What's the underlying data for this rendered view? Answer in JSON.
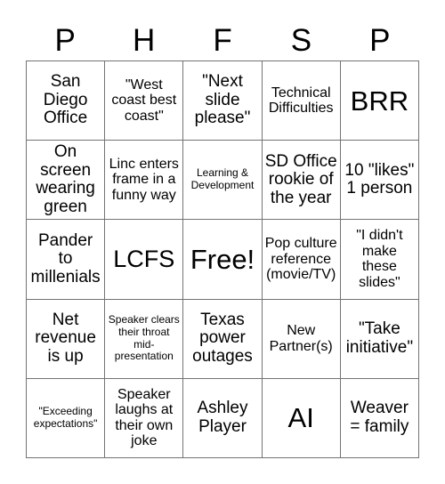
{
  "card": {
    "headers": [
      "P",
      "H",
      "F",
      "S",
      "P"
    ],
    "rows": [
      [
        {
          "text": "San Diego Office",
          "size": "md"
        },
        {
          "text": "\"West coast best coast\"",
          "size": "sm"
        },
        {
          "text": "\"Next slide please\"",
          "size": "md"
        },
        {
          "text": "Technical Difficulties",
          "size": "sm"
        },
        {
          "text": "BRR",
          "size": "xl"
        }
      ],
      [
        {
          "text": "On screen wearing green",
          "size": "md"
        },
        {
          "text": "Linc enters frame in a funny way",
          "size": "sm"
        },
        {
          "text": "Learning & Development",
          "size": "xs"
        },
        {
          "text": "SD Office rookie of the year",
          "size": "md"
        },
        {
          "text": "10 \"likes\" 1 person",
          "size": "md"
        }
      ],
      [
        {
          "text": "Pander to millenials",
          "size": "md"
        },
        {
          "text": "LCFS",
          "size": "lg"
        },
        {
          "text": "Free!",
          "size": "xl"
        },
        {
          "text": "Pop culture reference (movie/TV)",
          "size": "sm"
        },
        {
          "text": "\"I didn't make these slides\"",
          "size": "sm"
        }
      ],
      [
        {
          "text": "Net revenue is up",
          "size": "md"
        },
        {
          "text": "Speaker clears their throat mid-presentation",
          "size": "xs"
        },
        {
          "text": "Texas power outages",
          "size": "md"
        },
        {
          "text": "New Partner(s)",
          "size": "sm"
        },
        {
          "text": "\"Take initiative\"",
          "size": "md"
        }
      ],
      [
        {
          "text": "\"Exceeding expectations\"",
          "size": "xs"
        },
        {
          "text": "Speaker laughs at their own joke",
          "size": "sm"
        },
        {
          "text": "Ashley Player",
          "size": "md"
        },
        {
          "text": "AI",
          "size": "xl"
        },
        {
          "text": "Weaver = family",
          "size": "md"
        }
      ]
    ]
  }
}
